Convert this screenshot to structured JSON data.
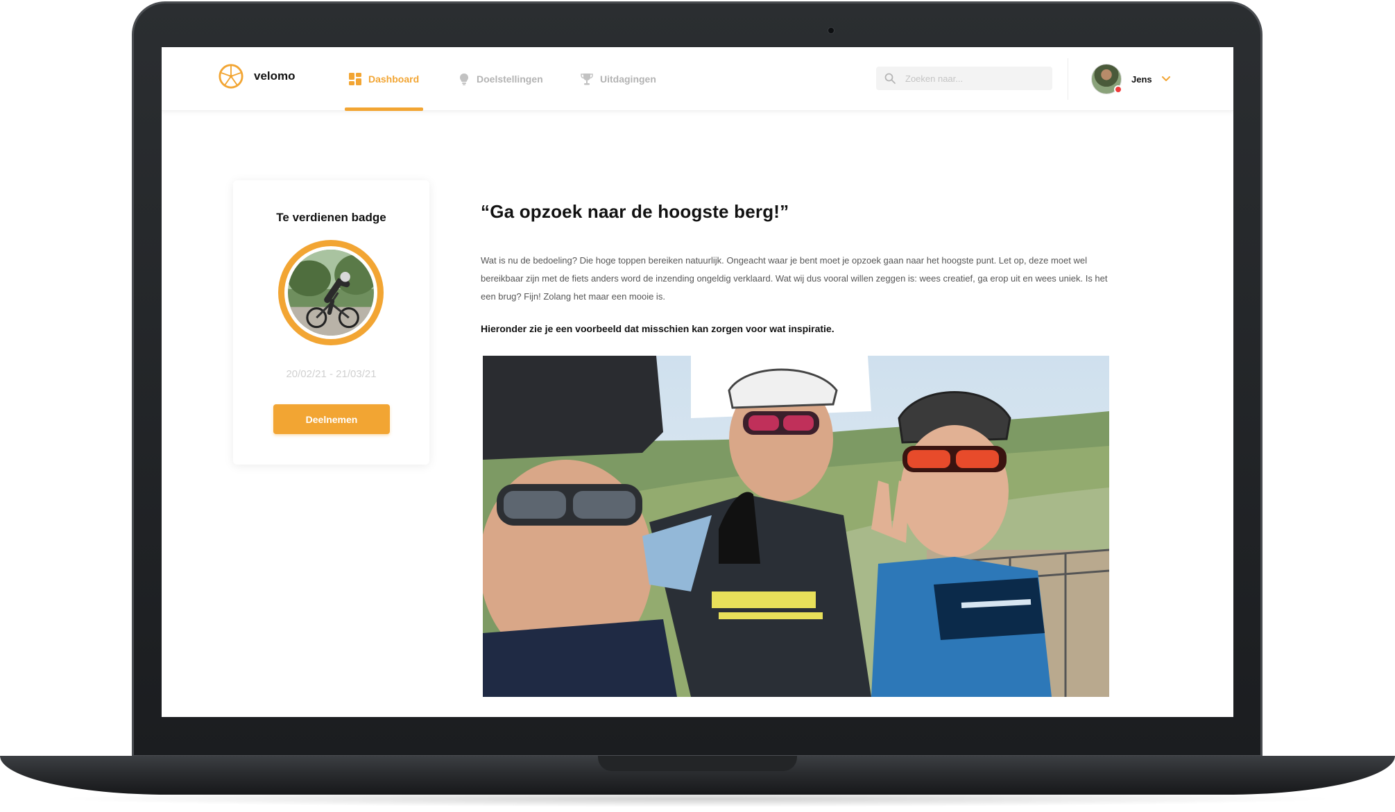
{
  "app": {
    "name": "velomo"
  },
  "nav": {
    "items": [
      {
        "label": "Dashboard",
        "active": true,
        "icon": "dashboard-grid-icon"
      },
      {
        "label": "Doelstellingen",
        "active": false,
        "icon": "goal-bulb-icon"
      },
      {
        "label": "Uitdagingen",
        "active": false,
        "icon": "trophy-icon"
      }
    ]
  },
  "search": {
    "placeholder": "Zoeken naar...",
    "value": ""
  },
  "user": {
    "name": "Jens",
    "status": "notification-dot"
  },
  "badge": {
    "title": "Te verdienen badge",
    "dates": "20/02/21 - 21/03/21",
    "button_label": "Deelnemen"
  },
  "article": {
    "title": "“Ga opzoek naar de hoogste berg!”",
    "body": "Wat is nu de bedoeling? Die hoge toppen bereiken natuurlijk. Ongeacht waar je bent moet je opzoek gaan naar het hoogste punt. Let op, deze moet wel bereikbaar zijn met de fiets anders word de inzending ongeldig verklaard. Wat wij dus vooral willen zeggen is: wees creatief, ga erop uit en wees uniek. Is het een brug? Fijn! Zolang het maar een mooie is.",
    "subheading": "Hieronder zie je een voorbeeld dat misschien kan zorgen voor wat inspiratie."
  },
  "colors": {
    "accent": "#f2a533",
    "text": "#111111",
    "muted": "#b3b3b3",
    "status": "#ef3b3b"
  }
}
